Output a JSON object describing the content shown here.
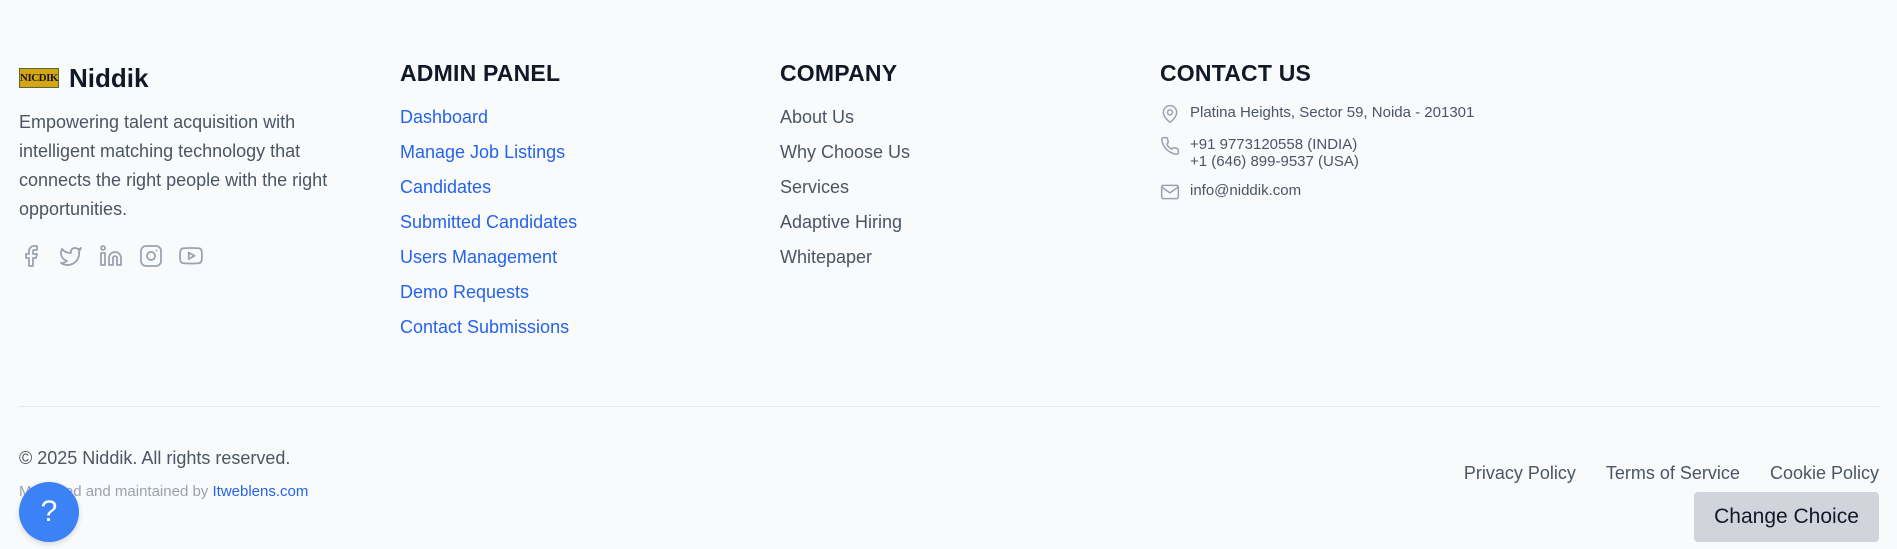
{
  "brand": {
    "logo_text": "NICDIK",
    "name": "Niddik",
    "description": "Empowering talent acquisition with intelligent matching technology that connects the right people with the right opportunities.",
    "socials": [
      "facebook-icon",
      "twitter-icon",
      "linkedin-icon",
      "instagram-icon",
      "youtube-icon"
    ]
  },
  "admin_panel": {
    "title": "ADMIN PANEL",
    "links": [
      "Dashboard",
      "Manage Job Listings",
      "Candidates",
      "Submitted Candidates",
      "Users Management",
      "Demo Requests",
      "Contact Submissions"
    ]
  },
  "company": {
    "title": "COMPANY",
    "links": [
      "About Us",
      "Why Choose Us",
      "Services",
      "Adaptive Hiring",
      "Whitepaper"
    ]
  },
  "contact": {
    "title": "CONTACT US",
    "address": "Platina Heights, Sector 59, Noida - 201301",
    "phone_india": "+91 9773120558 (INDIA)",
    "phone_usa": "+1 (646) 899-9537 (USA)",
    "email": "info@niddik.com"
  },
  "bottom": {
    "copyright": "© 2025 Niddik. All rights reserved.",
    "maintained_prefix": "Managed and maintained by ",
    "maintained_link": "Itweblens.com",
    "legal_links": [
      "Privacy Policy",
      "Terms of Service",
      "Cookie Policy"
    ],
    "change_choice_label": "Change Choice",
    "help_label": "?"
  },
  "colors": {
    "accent_link": "#2563eb",
    "help_button": "#3b82f6",
    "background": "#f8fafc"
  }
}
